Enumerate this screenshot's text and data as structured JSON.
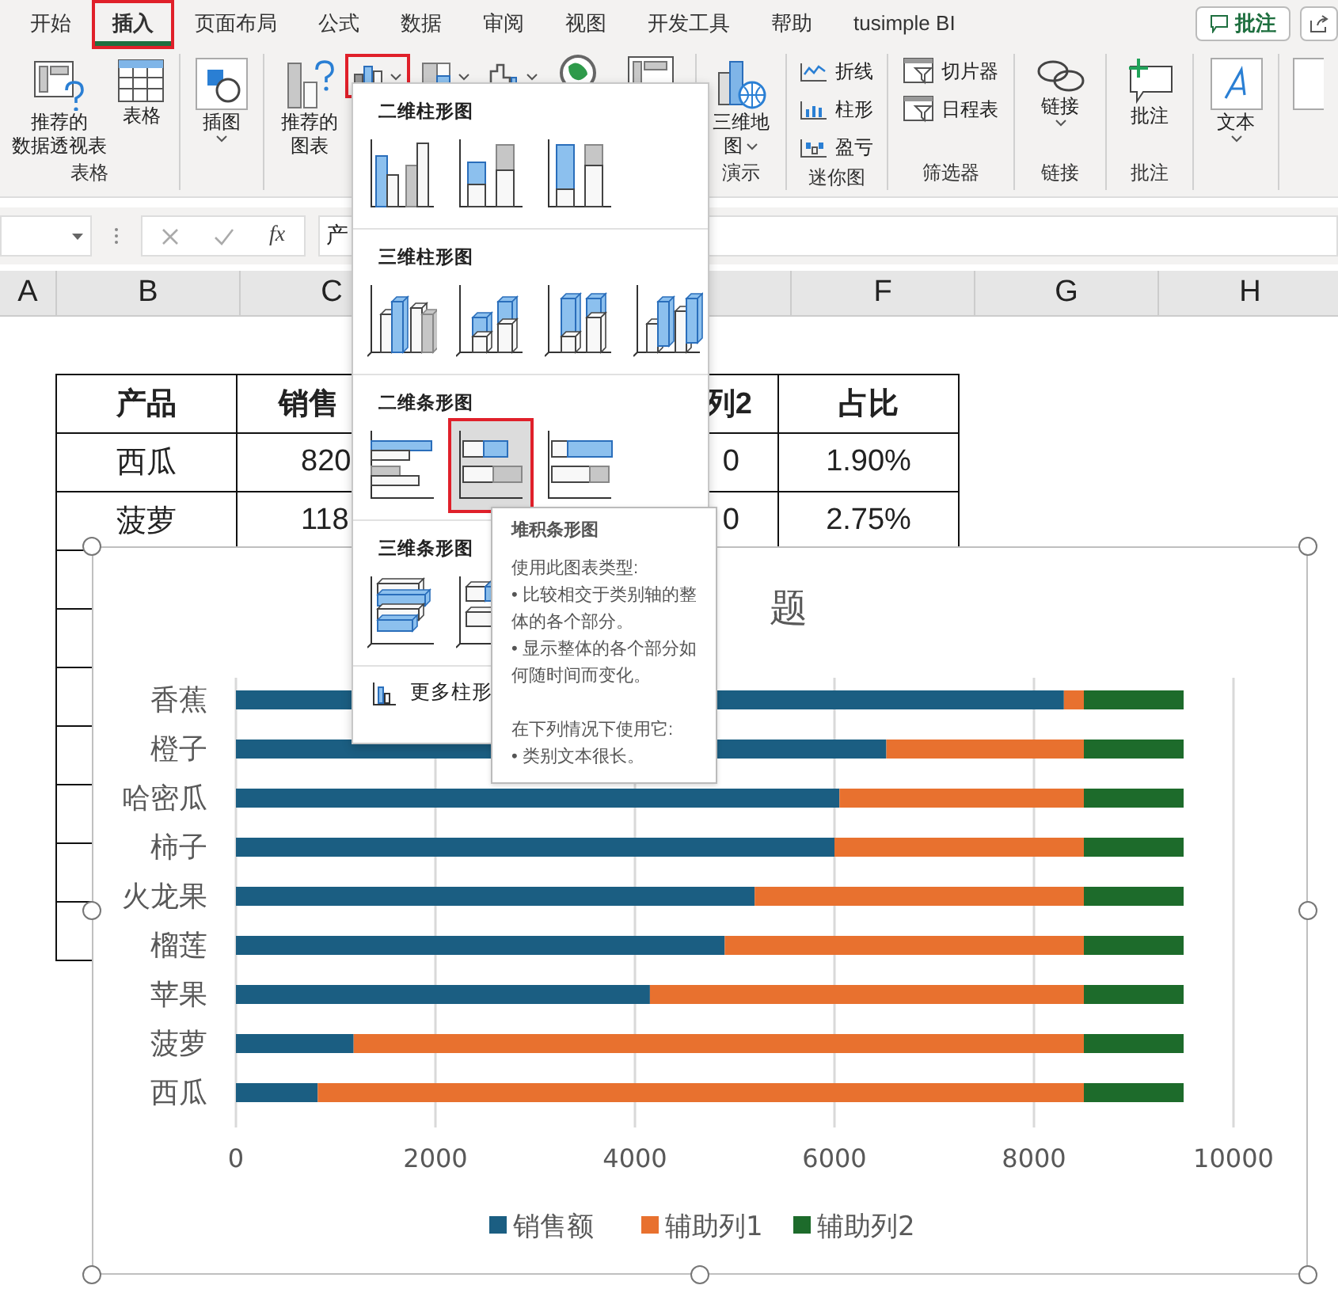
{
  "tabs": [
    {
      "label": "开始",
      "selected": false,
      "highlighted": false
    },
    {
      "label": "插入",
      "selected": true,
      "highlighted": true
    },
    {
      "label": "页面布局",
      "selected": false,
      "highlighted": false
    },
    {
      "label": "公式",
      "selected": false,
      "highlighted": false
    },
    {
      "label": "数据",
      "selected": false,
      "highlighted": false
    },
    {
      "label": "审阅",
      "selected": false,
      "highlighted": false
    },
    {
      "label": "视图",
      "selected": false,
      "highlighted": false
    },
    {
      "label": "开发工具",
      "selected": false,
      "highlighted": false
    },
    {
      "label": "帮助",
      "selected": false,
      "highlighted": false
    },
    {
      "label": "tusimple BI",
      "selected": false,
      "highlighted": false
    }
  ],
  "comment_button": {
    "label": "批注"
  },
  "ribbon_groups": [
    {
      "label": "表格",
      "items": [
        {
          "kind": "pivot-table",
          "lines": [
            "推荐的",
            "数据透视表"
          ]
        },
        {
          "kind": "table",
          "lines": [
            "表格"
          ]
        }
      ]
    },
    {
      "items": [
        {
          "kind": "illustrations",
          "lines": [
            "插图"
          ],
          "dropdown": true
        }
      ]
    },
    {
      "items": [
        {
          "kind": "recommended-charts",
          "lines": [
            "推荐的",
            "图表"
          ]
        },
        {
          "kind": "column-chart",
          "dropdown": true,
          "highlighted": true
        },
        {
          "kind": "hierarchy-chart",
          "dropdown": true,
          "highlighted": false
        },
        {
          "kind": "waterfall-chart",
          "dropdown": true,
          "highlighted": false
        },
        {
          "kind": "maps"
        },
        {
          "kind": "pivot-chart"
        }
      ]
    },
    {
      "label": "演示",
      "items": [
        {
          "kind": "spatial-map",
          "lines": [
            "三维地",
            "图"
          ],
          "dropdown": true
        }
      ]
    },
    {
      "label": "迷你图",
      "items": [
        {
          "kind": "sparkline-line",
          "lines": [
            "折线"
          ]
        },
        {
          "kind": "sparkline-column",
          "lines": [
            "柱形"
          ]
        },
        {
          "kind": "sparkline-winloss",
          "lines": [
            "盈亏"
          ]
        }
      ]
    },
    {
      "label": "筛选器",
      "items": [
        {
          "kind": "slicer",
          "lines": [
            "切片器"
          ]
        },
        {
          "kind": "timeline",
          "lines": [
            "日程表"
          ]
        }
      ]
    },
    {
      "label": "链接",
      "items": [
        {
          "kind": "link",
          "lines": [
            "链接"
          ],
          "dropdown": true
        }
      ]
    },
    {
      "label": "批注",
      "items": [
        {
          "kind": "comment",
          "lines": [
            "批注"
          ]
        }
      ]
    },
    {
      "items": [
        {
          "kind": "text",
          "lines": [
            "文本"
          ],
          "dropdown": true
        }
      ]
    },
    {
      "items": [
        {
          "kind": "symbols"
        }
      ]
    }
  ],
  "formula_bar": {
    "function_label": "fx",
    "value": "产"
  },
  "column_headers": [
    "A",
    "B",
    "C",
    "F",
    "G",
    "H"
  ],
  "table": {
    "header": [
      "产品",
      "销售",
      "列2",
      "占比"
    ],
    "rows": [
      [
        "西瓜",
        "820",
        "0",
        "1.90%"
      ],
      [
        "菠萝",
        "118",
        "0",
        "2.75%"
      ]
    ]
  },
  "chart": {
    "title": "题",
    "chart_data": {
      "type": "bar",
      "orientation": "horizontal",
      "stacked": true,
      "grid": true,
      "legend": "bottom",
      "categories": [
        "香蕉",
        "橙子",
        "哈密瓜",
        "柿子",
        "火龙果",
        "榴莲",
        "苹果",
        "菠萝",
        "西瓜"
      ],
      "series": [
        {
          "name": "销售额",
          "color": "#1b5e82",
          "values": [
            8300,
            6520,
            6050,
            6000,
            5200,
            4900,
            4150,
            1180,
            820
          ]
        },
        {
          "name": "辅助列1",
          "color": "#e8712f",
          "values": [
            200,
            1980,
            2450,
            2500,
            3300,
            3600,
            4350,
            7320,
            7680
          ]
        },
        {
          "name": "辅助列2",
          "color": "#1d6b2b",
          "values": [
            1000,
            1000,
            1000,
            1000,
            1000,
            1000,
            1000,
            1000,
            1000
          ]
        }
      ],
      "xlim": [
        0,
        10000
      ],
      "xticks": [
        0,
        2000,
        4000,
        6000,
        8000,
        10000
      ]
    }
  },
  "gallery": {
    "sections": [
      {
        "title": "二维柱形图",
        "options": [
          {
            "kind": "clustered-column",
            "selected": false,
            "highlighted": false
          },
          {
            "kind": "stacked-column",
            "selected": false,
            "highlighted": false
          },
          {
            "kind": "percent-column",
            "selected": false,
            "highlighted": false
          }
        ]
      },
      {
        "title": "三维柱形图",
        "options": [
          {
            "kind": "solid-clustered-column",
            "selected": false,
            "highlighted": false
          },
          {
            "kind": "solid-stacked-column",
            "selected": false,
            "highlighted": false
          },
          {
            "kind": "solid-percent-column",
            "selected": false,
            "highlighted": false
          },
          {
            "kind": "solid-column",
            "selected": false,
            "highlighted": false
          }
        ]
      },
      {
        "title": "二维条形图",
        "options": [
          {
            "kind": "clustered-bar",
            "selected": false,
            "highlighted": false
          },
          {
            "kind": "stacked-bar",
            "selected": true,
            "highlighted": true
          },
          {
            "kind": "percent-bar",
            "selected": false,
            "highlighted": false
          }
        ]
      },
      {
        "title": "三维条形图",
        "options": [
          {
            "kind": "solid-clustered-bar",
            "selected": false,
            "highlighted": false
          },
          {
            "kind": "solid-stacked-bar",
            "selected": false,
            "highlighted": false
          }
        ]
      }
    ],
    "more_link": "更多柱形"
  },
  "tooltip": {
    "title": "堆积条形图",
    "paragraphs": [
      "使用此图表类型:",
      "• 比较相交于类别轴的整体的各个部分。",
      "• 显示整体的各个部分如何随时间而变化。",
      "在下列情况下使用它:",
      "• 类别文本很长。"
    ]
  }
}
